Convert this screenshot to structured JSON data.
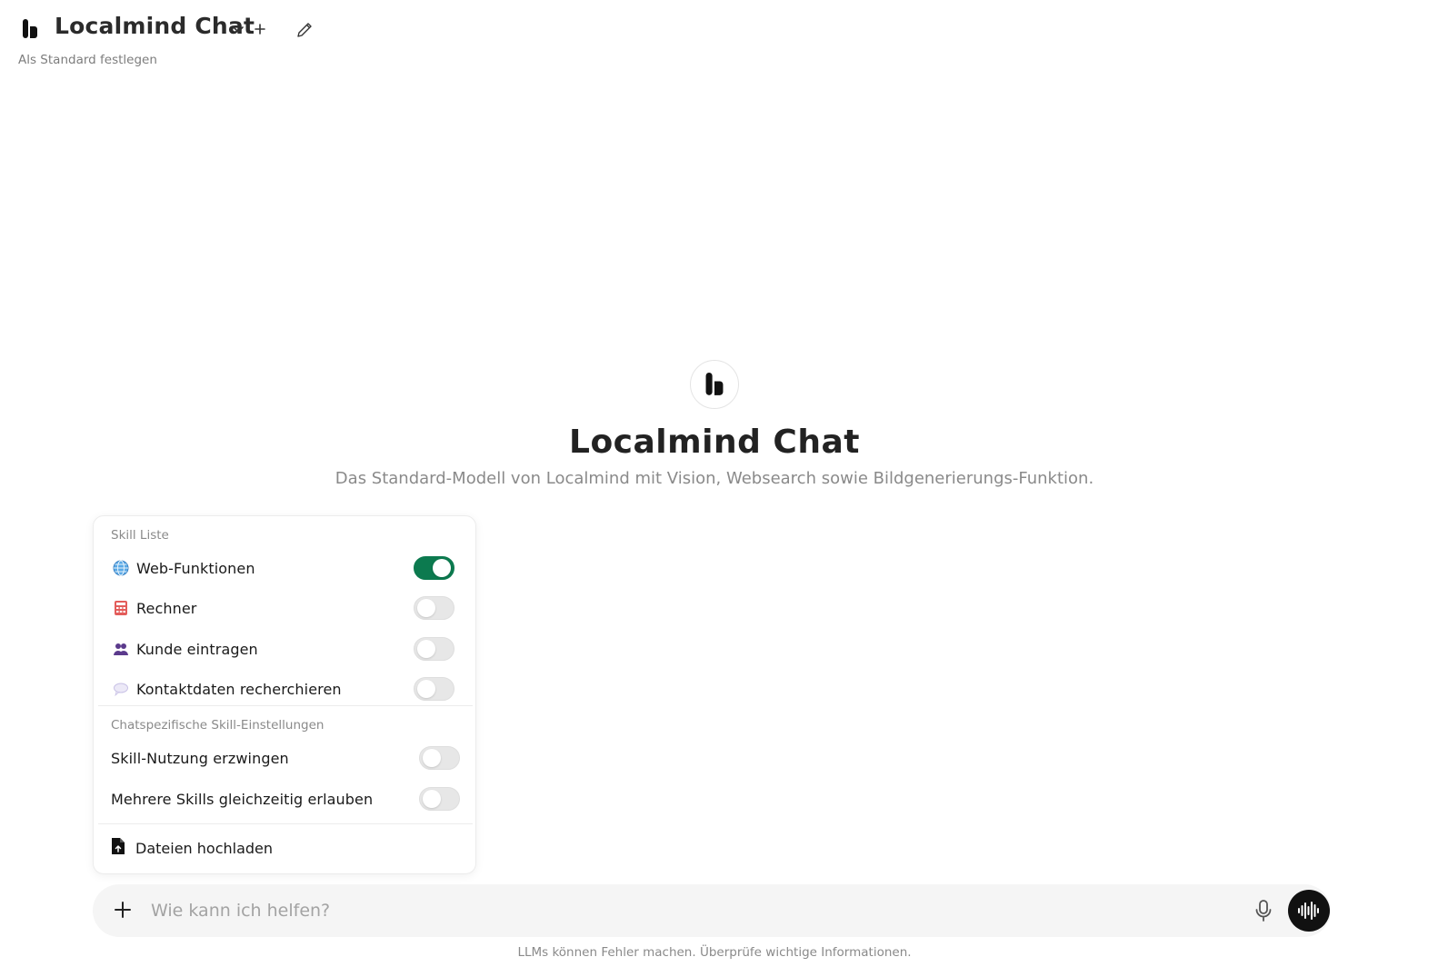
{
  "header": {
    "title": "Localmind Chat",
    "set_default": "Als Standard festlegen"
  },
  "hero": {
    "title": "Localmind Chat",
    "description": "Das Standard-Modell von Localmind mit Vision, Websearch sowie Bildgenerierungs-Funktion."
  },
  "skills_popup": {
    "section_label": "Skill Liste",
    "skills": [
      {
        "label": "Web-Funktionen",
        "icon": "globe-icon",
        "enabled": true
      },
      {
        "label": "Rechner",
        "icon": "calculator-icon",
        "enabled": false
      },
      {
        "label": "Kunde eintragen",
        "icon": "users-icon",
        "enabled": false
      },
      {
        "label": "Kontaktdaten recherchieren",
        "icon": "speech-bubble-icon",
        "enabled": false
      }
    ],
    "chat_settings_label": "Chatspezifische Skill-Einstellungen",
    "chat_settings": [
      {
        "label": "Skill-Nutzung erzwingen",
        "enabled": false
      },
      {
        "label": "Mehrere Skills gleichzeitig erlauben",
        "enabled": false
      }
    ],
    "upload_label": "Dateien hochladen"
  },
  "input": {
    "placeholder": "Wie kann ich helfen?",
    "value": ""
  },
  "footer": {
    "disclaimer": "LLMs können Fehler machen. Überprüfe wichtige Informationen."
  },
  "colors": {
    "toggle_on": "#0c7a4f",
    "toggle_off": "#e7e7e7",
    "voice_button": "#111111"
  }
}
